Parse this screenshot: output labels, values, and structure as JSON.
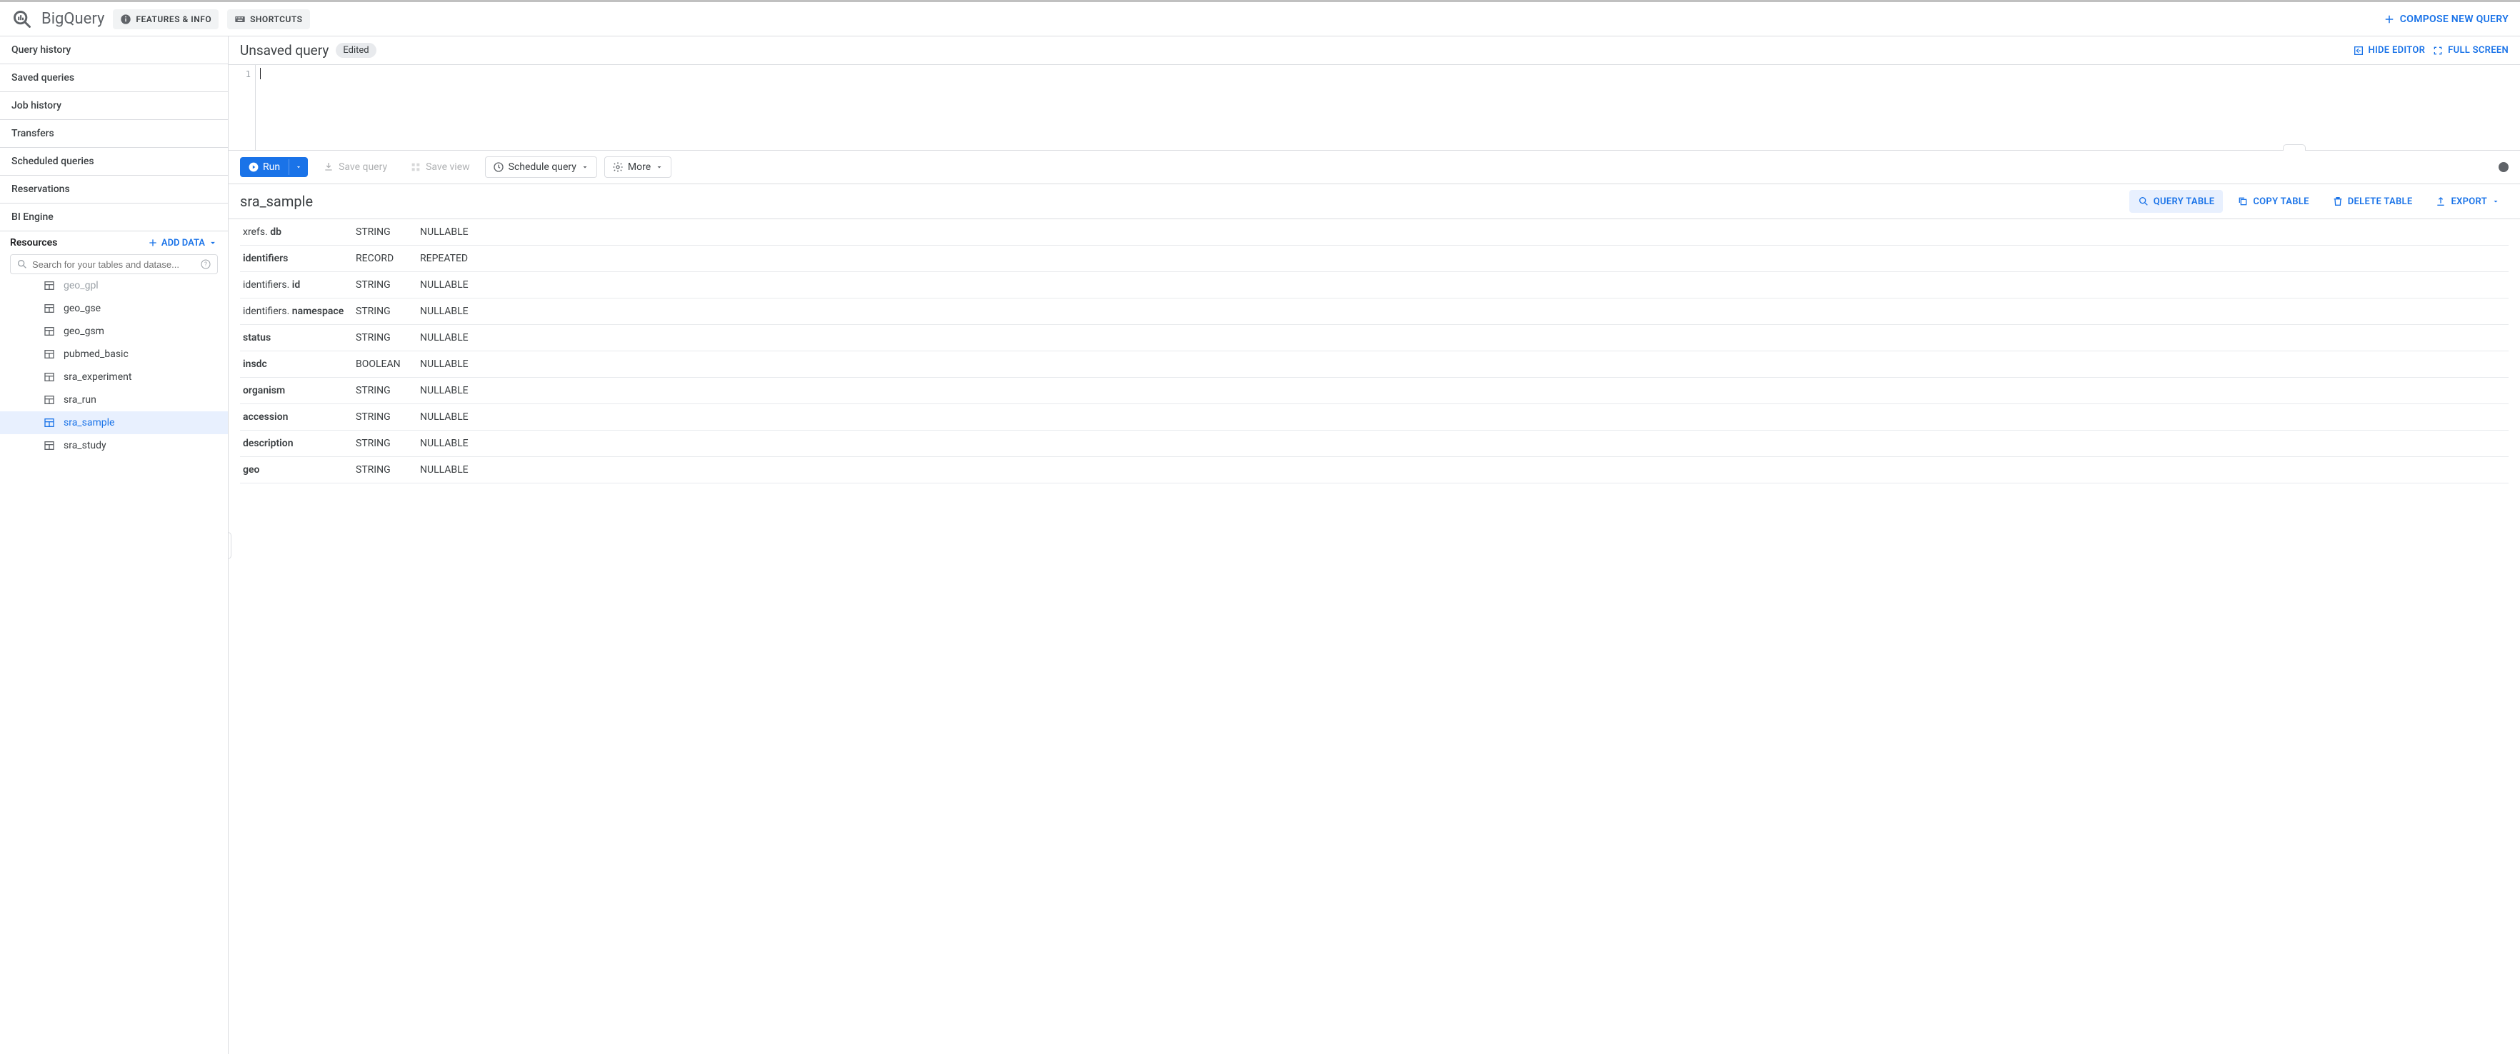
{
  "header": {
    "app_name": "BigQuery",
    "features_info": "FEATURES & INFO",
    "shortcuts": "SHORTCUTS",
    "compose": "COMPOSE NEW QUERY"
  },
  "sidebar": {
    "sections": {
      "query_history": "Query history",
      "saved_queries": "Saved queries",
      "job_history": "Job history",
      "transfers": "Transfers",
      "scheduled_queries": "Scheduled queries",
      "reservations": "Reservations",
      "bi_engine": "BI Engine"
    },
    "resources_label": "Resources",
    "add_data": "ADD DATA",
    "search_placeholder": "Search for your tables and datase...",
    "tables": {
      "cutoff": "geo_gpl",
      "t1": "geo_gse",
      "t2": "geo_gsm",
      "t3": "pubmed_basic",
      "t4": "sra_experiment",
      "t5": "sra_run",
      "t6": "sra_sample",
      "t7": "sra_study"
    }
  },
  "query": {
    "title": "Unsaved query",
    "badge": "Edited",
    "hide_editor": "HIDE EDITOR",
    "full_screen": "FULL SCREEN",
    "line_number": "1"
  },
  "toolbar": {
    "run": "Run",
    "save_query": "Save query",
    "save_view": "Save view",
    "schedule_query": "Schedule query",
    "more": "More"
  },
  "table": {
    "name": "sra_sample",
    "actions": {
      "query": "QUERY TABLE",
      "copy": "COPY TABLE",
      "delete": "DELETE TABLE",
      "export": "EXPORT"
    }
  },
  "schema": [
    {
      "prefix": "xrefs. ",
      "name": "db",
      "type": "STRING",
      "mode": "NULLABLE"
    },
    {
      "prefix": "",
      "name": "identifiers",
      "type": "RECORD",
      "mode": "REPEATED"
    },
    {
      "prefix": "identifiers. ",
      "name": "id",
      "type": "STRING",
      "mode": "NULLABLE"
    },
    {
      "prefix": "identifiers. ",
      "name": "namespace",
      "type": "STRING",
      "mode": "NULLABLE"
    },
    {
      "prefix": "",
      "name": "status",
      "type": "STRING",
      "mode": "NULLABLE"
    },
    {
      "prefix": "",
      "name": "insdc",
      "type": "BOOLEAN",
      "mode": "NULLABLE"
    },
    {
      "prefix": "",
      "name": "organism",
      "type": "STRING",
      "mode": "NULLABLE"
    },
    {
      "prefix": "",
      "name": "accession",
      "type": "STRING",
      "mode": "NULLABLE"
    },
    {
      "prefix": "",
      "name": "description",
      "type": "STRING",
      "mode": "NULLABLE"
    },
    {
      "prefix": "",
      "name": "geo",
      "type": "STRING",
      "mode": "NULLABLE"
    }
  ]
}
